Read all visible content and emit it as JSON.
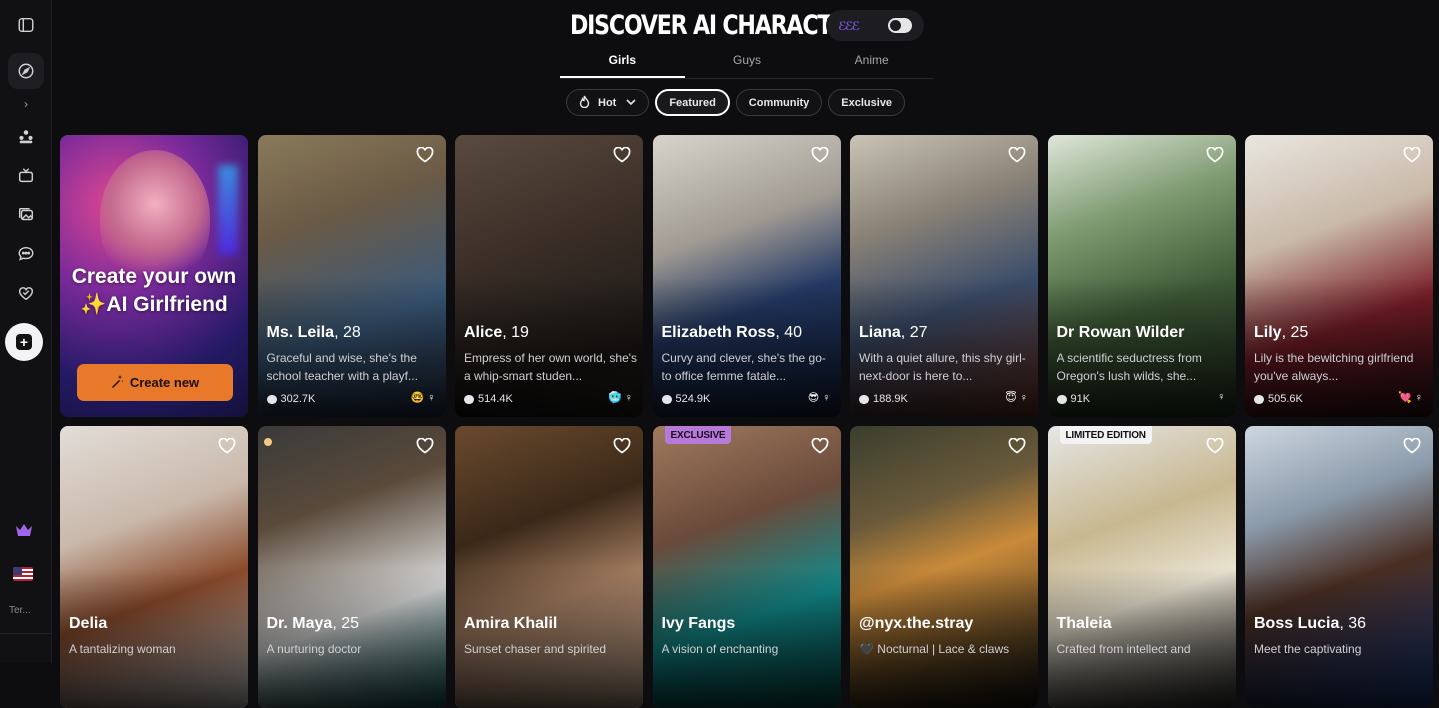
{
  "header": {
    "title": "DISCOVER AI CHARACTERS",
    "theme_toggle_icons": "ℰℰℰ"
  },
  "tabs": [
    {
      "label": "Girls",
      "active": true
    },
    {
      "label": "Guys",
      "active": false
    },
    {
      "label": "Anime",
      "active": false
    }
  ],
  "filters": {
    "sort": {
      "label": "Hot",
      "icon": "flame-icon"
    },
    "chips": [
      "Featured",
      "Community",
      "Exclusive"
    ],
    "active": "Featured"
  },
  "sidebar": {
    "items": [
      "panel-toggle-icon",
      "explore-icon",
      "chevron-right-icon",
      "community-icon",
      "tv-icon",
      "gallery-icon",
      "chat-icon",
      "heart-collection-icon",
      "create-icon"
    ],
    "terms_label": "Ter..."
  },
  "create_card": {
    "title": "Create your own ✨AI Girlfriend",
    "button_label": "Create new",
    "button_color": "#e8782a"
  },
  "characters": [
    {
      "name": "Ms. Leila",
      "age": ", 28",
      "desc": "Graceful and wise, she's the school teacher with a playf...",
      "count": "302.7K",
      "tags": "🤓 ♀",
      "bg": "linear-gradient(160deg,#8a7a5a 0%,#6b5a45 30%,#3b5a7a 65%,#2a3a55 100%)"
    },
    {
      "name": "Alice",
      "age": ", 19",
      "desc": "Empress of her own world, she's a whip-smart studen...",
      "count": "514.4K",
      "tags": "🥶 ♀",
      "bg": "linear-gradient(160deg,#5a4a3e 0%,#3a2e27 40%,#1c1816 80%,#2a2522 100%)"
    },
    {
      "name": "Elizabeth Ross",
      "age": ", 40",
      "desc": "Curvy and clever, she's the go-to office femme fatale...",
      "count": "524.9K",
      "tags": "😎 ♀",
      "bg": "linear-gradient(160deg,#d8d4cc 0%,#a09a92 35%,#243a66 60%,#16264a 100%)"
    },
    {
      "name": "Liana",
      "age": ", 27",
      "desc": "With a quiet allure, this shy girl-next-door is here to...",
      "count": "188.9K",
      "tags": "😇 ♀",
      "bg": "linear-gradient(160deg,#c9c4b6 0%,#8a8276 30%,#3a4c6a 60%,#7a3e2e 100%)"
    },
    {
      "name": "Dr Rowan Wilder",
      "age": "",
      "desc": "A scientific seductress from Oregon's lush wilds, she...",
      "count": "91K",
      "tags": "♀",
      "bg": "linear-gradient(160deg,#dfe6da 0%,#7d9a70 30%,#3e5a36 60%,#2a3a26 100%)"
    },
    {
      "name": "Lily",
      "age": ", 25",
      "desc": "Lily is the bewitching girlfriend you've always...",
      "count": "505.6K",
      "tags": "💘 ♀",
      "bg": "linear-gradient(160deg,#e9e6e0 0%,#c9b9a8 35%,#7a1e28 65%,#3a1418 100%)"
    },
    {
      "name": "Delia",
      "age": "",
      "desc": "A tantalizing woman",
      "count": "",
      "tags": "",
      "bg": "linear-gradient(160deg,#e2ddd8 0%,#c9b8aa 35%,#8a4a2a 60%,#efefef 100%)"
    },
    {
      "name": "Dr. Maya",
      "age": ", 25",
      "desc": "A nurturing doctor",
      "count": "",
      "tags": "",
      "dot": true,
      "bg": "linear-gradient(160deg,#3a3a3a 0%,#5a4a3a 30%,#dcdcdc 65%,#1f6a6a 100%)"
    },
    {
      "name": "Amira Khalil",
      "age": "",
      "desc": "Sunset chaser and spirited",
      "count": "",
      "tags": "",
      "bg": "linear-gradient(160deg,#6a4a2e 0%,#3a2818 35%,#a07a5e 60%,#d9b89c 100%)"
    },
    {
      "name": "Ivy Fangs",
      "age": "",
      "desc": "A vision of enchanting",
      "count": "",
      "tags": "",
      "badge": "EXCLUSIVE",
      "badge_class": "excl",
      "bg": "linear-gradient(160deg,#a07a5e 0%,#6a4a3a 35%,#128a8a 65%,#0a5a5a 100%)"
    },
    {
      "name": "@nyx.the.stray",
      "age": "",
      "desc": "🖤 Nocturnal | Lace & claws",
      "count": "",
      "tags": "",
      "bg": "linear-gradient(160deg,#3a3e2e 0%,#6a5a3a 30%,#c98a3a 50%,#1a1a14 100%)"
    },
    {
      "name": "Thaleia",
      "age": "",
      "desc": "Crafted from intellect and",
      "count": "",
      "tags": "",
      "badge": "LIMITED EDITION",
      "badge_class": "ltd",
      "bg": "linear-gradient(160deg,#e6e6e6 0%,#c8b890 35%,#e9e2d0 60%,#3a3a3a 100%)"
    },
    {
      "name": "Boss Lucia",
      "age": ", 36",
      "desc": "Meet the captivating",
      "count": "",
      "tags": "",
      "bg": "linear-gradient(160deg,#cdd6e0 0%,#8a9aaa 30%,#4a2e22 55%,#1e3f8a 100%)"
    }
  ],
  "colors": {
    "accent": "#e8782a",
    "exclusive_badge": "#b87ad8",
    "background": "#0d0d0f"
  }
}
